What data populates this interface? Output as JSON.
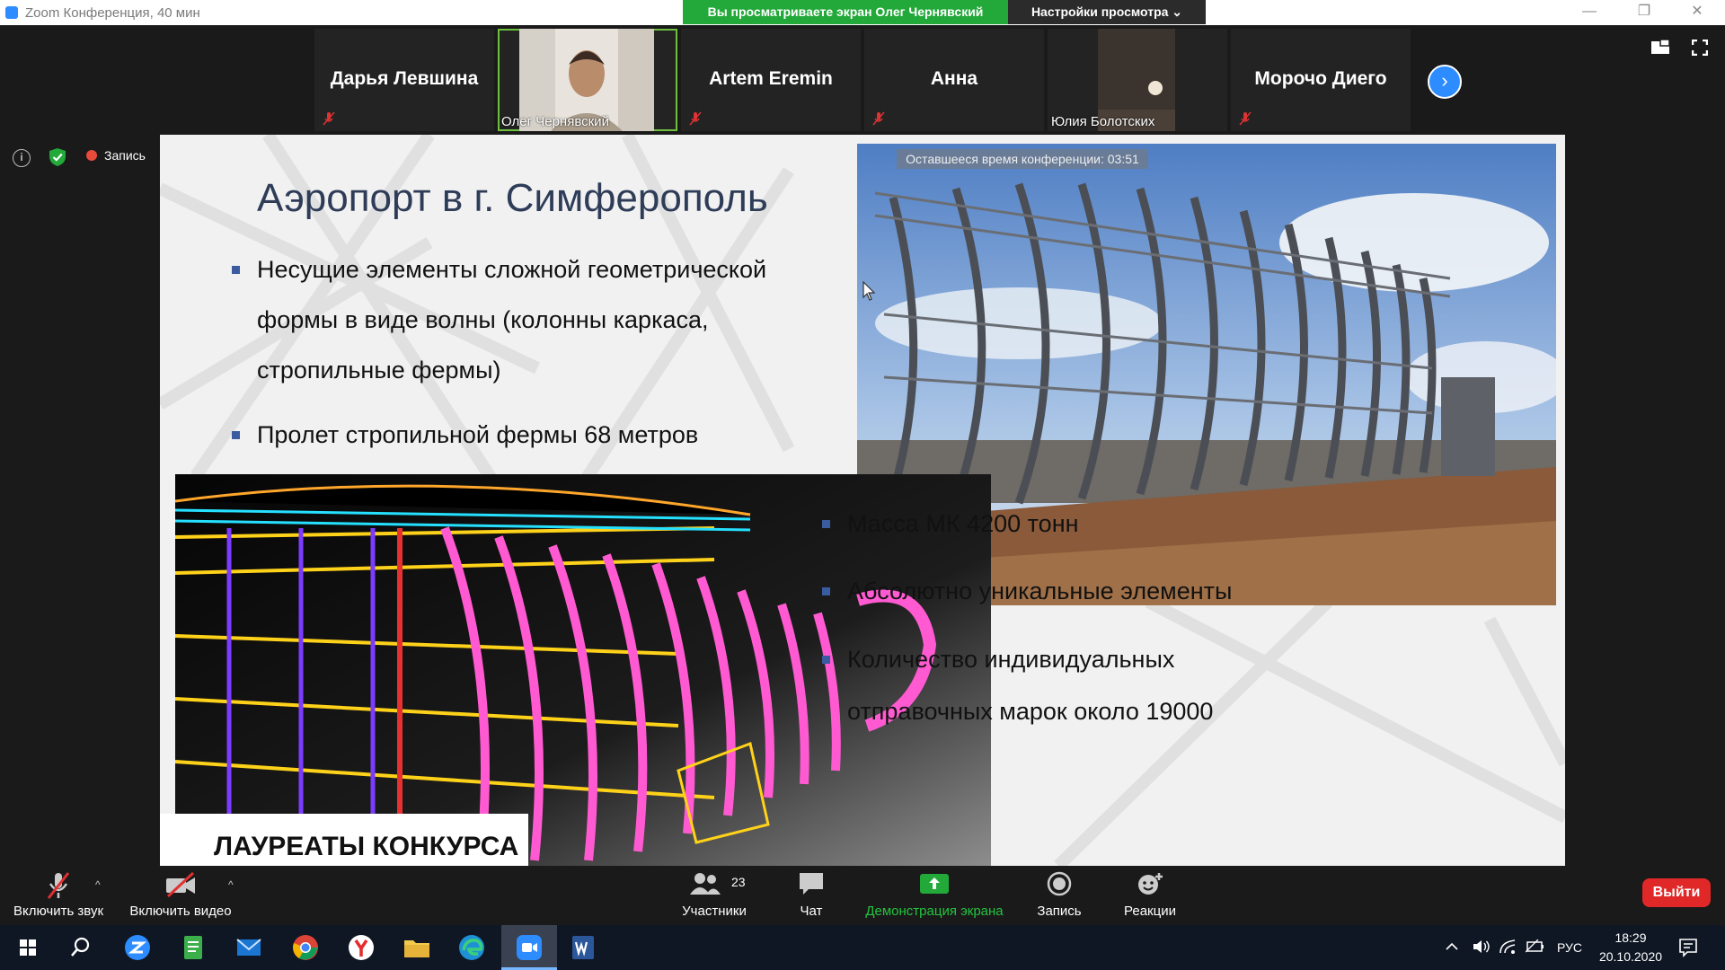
{
  "window": {
    "title": "Zoom Конференция, 40 мин",
    "share_banner": "Вы просматриваете экран Олег Чернявский",
    "view_options": "Настройки просмотра ⌄",
    "controls": [
      "—",
      "❐",
      "✕"
    ]
  },
  "participants": [
    {
      "name": "Дарья Левшина",
      "video": false,
      "muted": true
    },
    {
      "name": "Олег Чернявский",
      "video": true,
      "muted": false,
      "active": true
    },
    {
      "name": "Artem Eremin",
      "video": false,
      "muted": true
    },
    {
      "name": "Анна",
      "video": false,
      "muted": true
    },
    {
      "name": "Юлия Болотских",
      "video": true,
      "muted": false
    },
    {
      "name": "Морочо Диего",
      "video": false,
      "muted": true
    }
  ],
  "status": {
    "recording_label": "Запись"
  },
  "slide": {
    "timer": "Оставшееся время конференции: 03:51",
    "title": "Аэропорт в г. Симферополь",
    "bullets_top": [
      "Несущие элементы сложной геометрической",
      "формы в виде волны (колонны каркаса,",
      "стропильные фермы)",
      "Пролет стропильной фермы 68 метров"
    ],
    "bullets_bottom": [
      "Масса МК 4200 тонн",
      "Абсолютно уникальные элементы",
      "Количество индивидуальных",
      "отправочных марок около 19000"
    ],
    "laureates": "ЛАУРЕАТЫ КОНКУРСА"
  },
  "toolbar": {
    "audio": "Включить звук",
    "video": "Включить видео",
    "participants": "Участники",
    "participants_count": "23",
    "chat": "Чат",
    "share": "Демонстрация экрана",
    "record": "Запись",
    "reactions": "Реакции",
    "leave": "Выйти"
  },
  "taskbar": {
    "icons": [
      "windows-start-icon",
      "search-icon",
      "zoom-app-icon",
      "evernote-icon",
      "mail-icon",
      "chrome-icon",
      "yandex-browser-icon",
      "file-explorer-icon",
      "edge-icon",
      "zoom-meetings-icon",
      "word-icon"
    ],
    "language": "РУС",
    "time": "18:29",
    "date": "20.10.2020"
  },
  "colors": {
    "share_green": "#23a83a",
    "zoom_blue": "#2d8cff",
    "leave_red": "#e02828",
    "title_navy": "#2e3c58"
  }
}
